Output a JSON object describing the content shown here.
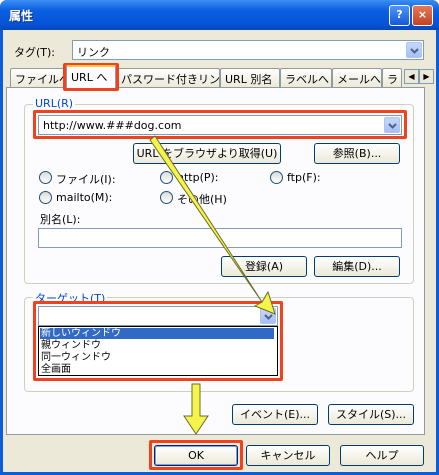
{
  "window": {
    "title": "属性",
    "help_glyph": "?",
    "close_glyph": "×"
  },
  "tag": {
    "label": "タグ(T):",
    "value": "リンク"
  },
  "tabs": [
    {
      "label": "ファイルへ"
    },
    {
      "label": "URL へ"
    },
    {
      "label": "パスワード付きリンク"
    },
    {
      "label": "URL 別名"
    },
    {
      "label": "ラベルへ"
    },
    {
      "label": "メールへ"
    },
    {
      "label": "ラ"
    }
  ],
  "url_group": {
    "title": "URL(R)",
    "url_value": "http://www.###dog.com",
    "fetch_button": "URL をブラウザより取得(U)",
    "browse_button": "参照(B)...",
    "radios": {
      "file": "ファイル(I):",
      "http": "http(P):",
      "ftp": "ftp(F):",
      "mailto": "mailto(M):",
      "other": "その他(H)"
    },
    "alias_label": "別名(L):",
    "alias_value": "",
    "register_button": "登録(A)",
    "edit_button": "編集(D)..."
  },
  "target_group": {
    "title": "ターゲット(T)",
    "value": "",
    "options": [
      "新しいウィンドウ",
      "親ウィンドウ",
      "同一ウィンドウ",
      "全画面"
    ],
    "selected_index": 0
  },
  "event_button": "イベント(E)...",
  "style_button": "スタイル(S)...",
  "footer": {
    "ok": "OK",
    "cancel": "キャンセル",
    "help": "ヘルプ"
  },
  "colors": {
    "highlight": "#f0421c",
    "arrow": "#f4f44a",
    "selection": "#316ac5"
  }
}
